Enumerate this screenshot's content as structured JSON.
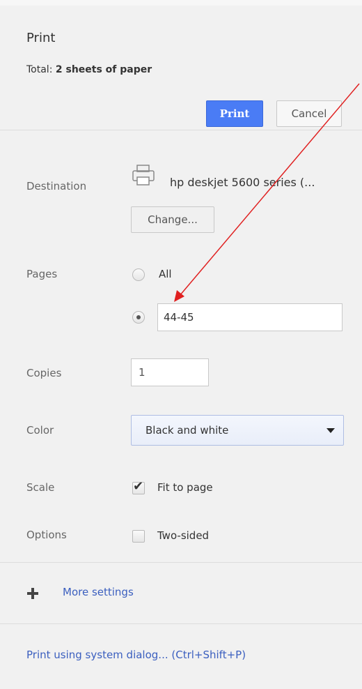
{
  "header": {
    "title": "Print",
    "total_prefix": "Total: ",
    "total_value": "2 sheets of paper",
    "print_button": "Print",
    "cancel_button": "Cancel"
  },
  "destination": {
    "label": "Destination",
    "printer_name": "hp deskjet 5600 series (...",
    "change_button": "Change..."
  },
  "pages": {
    "label": "Pages",
    "option_all": "All",
    "custom_value": "44-45",
    "selected": "custom"
  },
  "copies": {
    "label": "Copies",
    "value": "1"
  },
  "color": {
    "label": "Color",
    "selected": "Black and white"
  },
  "scale": {
    "label": "Scale",
    "option": "Fit to page",
    "checked": true
  },
  "options": {
    "label": "Options",
    "option": "Two-sided",
    "checked": false
  },
  "more_settings": "More settings",
  "system_dialog_link": "Print using system dialog... (Ctrl+Shift+P)",
  "colors": {
    "accent": "#4a7cf5",
    "link": "#3b5fbf",
    "annotation": "#e02020"
  }
}
